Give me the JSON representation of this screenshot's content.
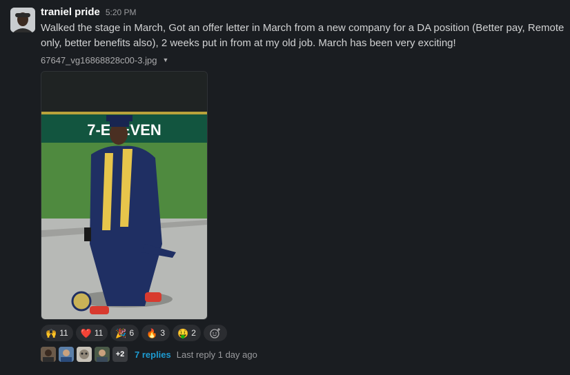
{
  "message": {
    "author": "traniel pride",
    "timestamp": "5:20 PM",
    "text": "Walked the stage in March, Got an offer letter  in March from a new company for a DA position (Better pay, Remote only, better benefits also), 2 weeks put in from at my old job. March has been very exciting!",
    "file_name": "67647_vg16868828c00-3.jpg",
    "image_overlay_text": "7-ELEVEN"
  },
  "reactions": [
    {
      "emoji": "🙌",
      "count": "11",
      "icon": "raised-hands-icon"
    },
    {
      "emoji": "❤️",
      "count": "11",
      "icon": "heart-icon"
    },
    {
      "emoji": "🎉",
      "count": "6",
      "icon": "party-popper-icon"
    },
    {
      "emoji": "🔥",
      "count": "3",
      "icon": "fire-icon"
    },
    {
      "emoji": "🤑",
      "count": "2",
      "icon": "money-mouth-icon"
    }
  ],
  "add_reaction_icon": "add-reaction-icon",
  "thread": {
    "extra_count": "+2",
    "replies": "7 replies",
    "last_reply": "Last reply 1 day ago"
  },
  "colors": {
    "background": "#1a1d21",
    "link": "#1d9bd1",
    "reaction_bg": "#2b2d31"
  }
}
